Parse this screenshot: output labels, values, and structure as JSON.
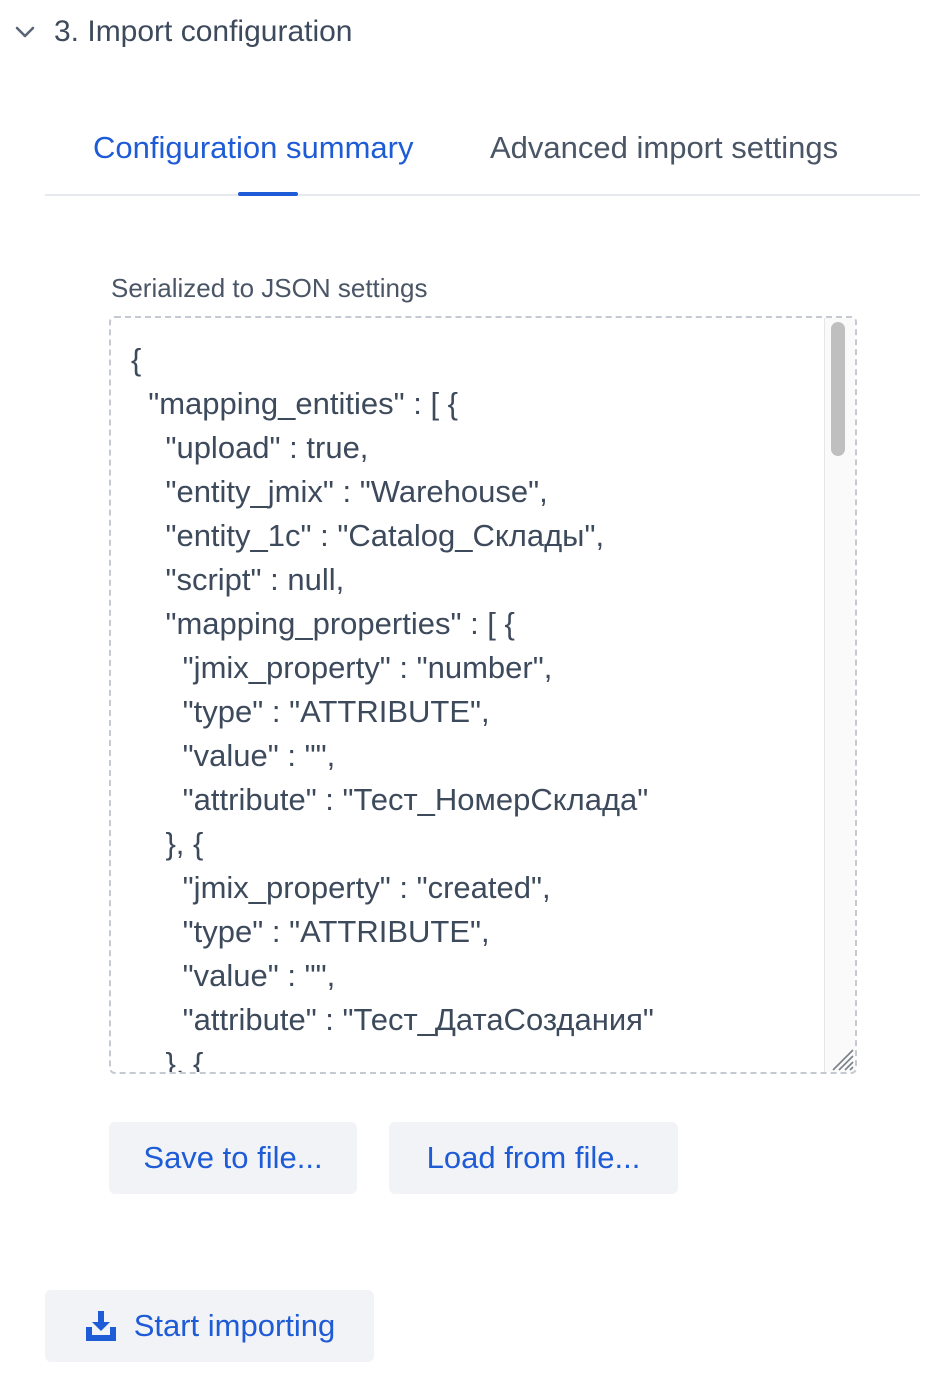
{
  "section": {
    "title": "3. Import configuration",
    "chevron_icon": "chevron-down-icon"
  },
  "tabs": [
    {
      "label": "Configuration summary",
      "selected": true
    },
    {
      "label": "Advanced import settings",
      "selected": false
    }
  ],
  "colors": {
    "accent": "#1e5bd6",
    "text": "#3d4a5c",
    "button_bg": "#f1f3f6"
  },
  "json_field": {
    "label": "Serialized to JSON settings",
    "value": "{\n  \"mapping_entities\" : [ {\n    \"upload\" : true,\n    \"entity_jmix\" : \"Warehouse\",\n    \"entity_1c\" : \"Catalog_Склады\",\n    \"script\" : null,\n    \"mapping_properties\" : [ {\n      \"jmix_property\" : \"number\",\n      \"type\" : \"ATTRIBUTE\",\n      \"value\" : \"\",\n      \"attribute\" : \"Тест_НомерСклада\"\n    }, {\n      \"jmix_property\" : \"created\",\n      \"type\" : \"ATTRIBUTE\",\n      \"value\" : \"\",\n      \"attribute\" : \"Тест_ДатаСоздания\"\n    }, {"
  },
  "buttons": {
    "save": "Save to file...",
    "load": "Load from file...",
    "start": "Start importing",
    "start_icon": "download-icon"
  }
}
